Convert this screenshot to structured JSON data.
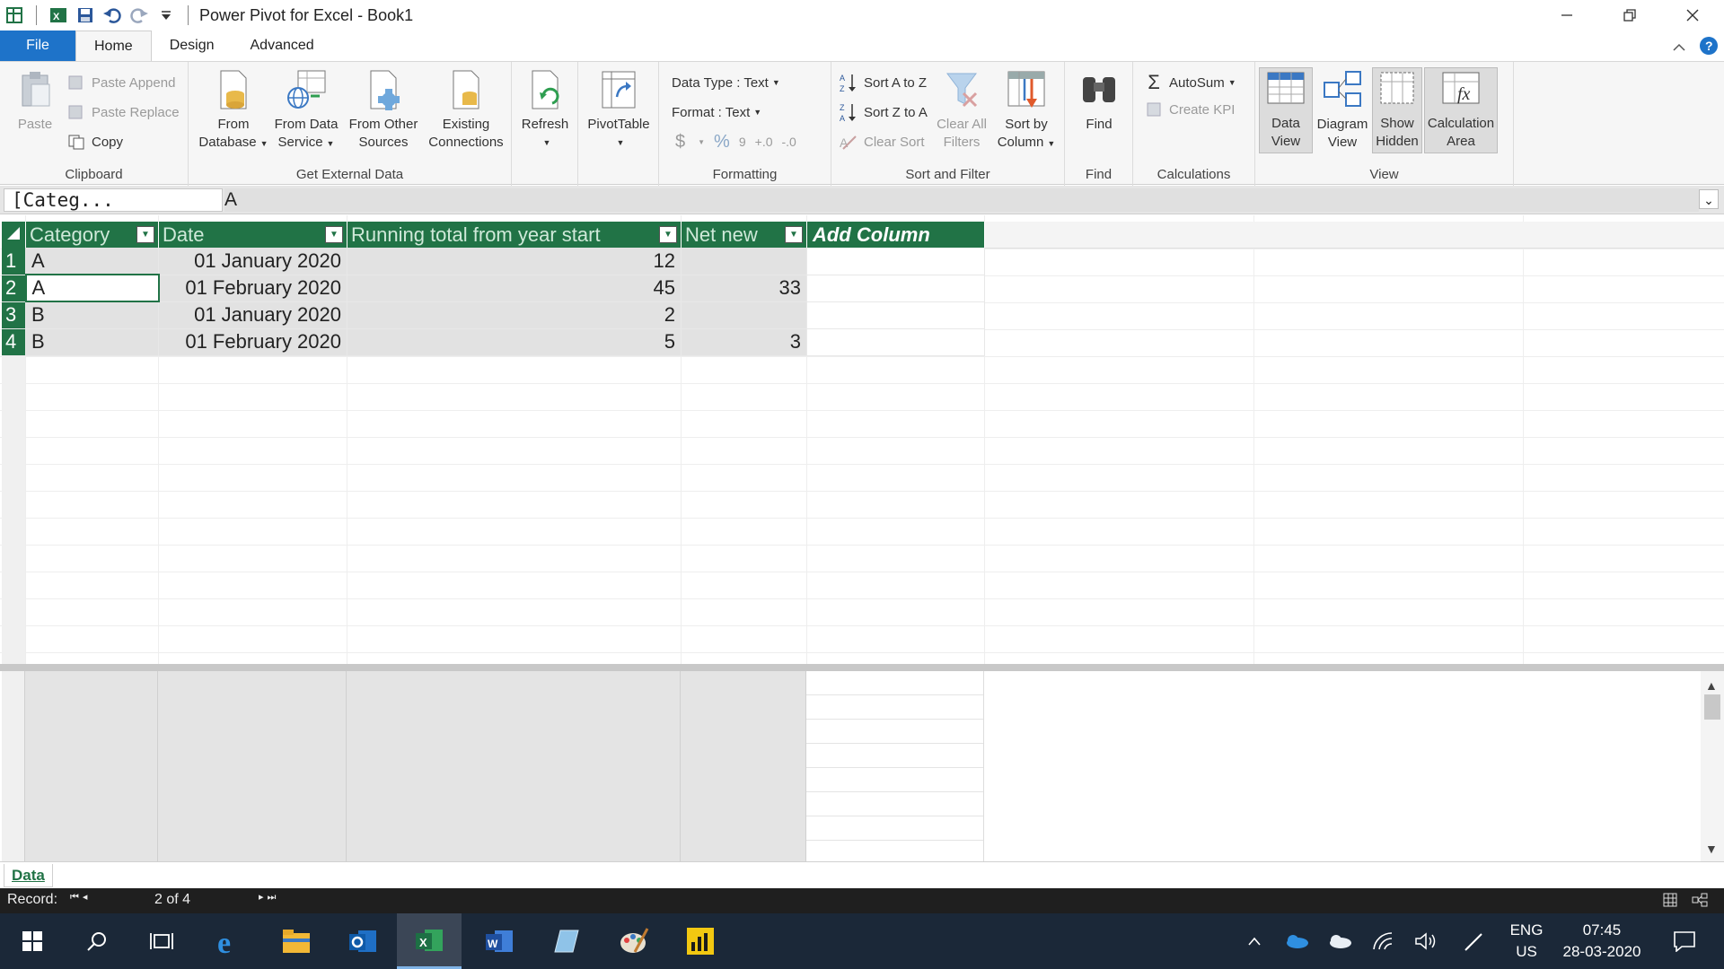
{
  "window": {
    "title": "Power Pivot for Excel - Book1"
  },
  "tabs": [
    {
      "label": "File"
    },
    {
      "label": "Home"
    },
    {
      "label": "Design"
    },
    {
      "label": "Advanced"
    }
  ],
  "ribbon": {
    "clipboard": {
      "label": "Clipboard",
      "paste": "Paste",
      "paste_append": "Paste Append",
      "paste_replace": "Paste Replace",
      "copy": "Copy"
    },
    "external": {
      "label": "Get External Data",
      "from_database_1": "From",
      "from_database_2": "Database",
      "from_data_service_1": "From Data",
      "from_data_service_2": "Service",
      "from_other_1": "From Other",
      "from_other_2": "Sources",
      "existing_1": "Existing",
      "existing_2": "Connections"
    },
    "refresh": {
      "label": "Refresh"
    },
    "pivottable": {
      "label": "PivotTable"
    },
    "formatting": {
      "label": "Formatting",
      "data_type": "Data Type : Text",
      "format": "Format : Text",
      "currency": "$",
      "percent": "%",
      "comma": "9",
      "inc_decimal": "+.0",
      "dec_decimal": "-.0"
    },
    "sortfilter": {
      "label": "Sort and Filter",
      "sort_az": "Sort A to Z",
      "sort_za": "Sort Z to A",
      "clear_sort": "Clear Sort",
      "clear_filters_1": "Clear All",
      "clear_filters_2": "Filters",
      "sort_by_1": "Sort by",
      "sort_by_2": "Column"
    },
    "find": {
      "label": "Find",
      "button": "Find"
    },
    "calculations": {
      "label": "Calculations",
      "autosum": "AutoSum",
      "create_kpi": "Create KPI"
    },
    "view": {
      "label": "View",
      "data_view_1": "Data",
      "data_view_2": "View",
      "diagram_1": "Diagram",
      "diagram_2": "View",
      "show_hidden_1": "Show",
      "show_hidden_2": "Hidden",
      "calc_area_1": "Calculation",
      "calc_area_2": "Area"
    }
  },
  "formula_bar": {
    "name_box": "[Categ...",
    "value": "A"
  },
  "table": {
    "columns": [
      "Category",
      "Date",
      "Running total from year start",
      "Net new",
      "Add Column"
    ],
    "rows": [
      {
        "n": "1",
        "category": "A",
        "date": "01 January 2020",
        "total": "12",
        "net": ""
      },
      {
        "n": "2",
        "category": "A",
        "date": "01 February 2020",
        "total": "45",
        "net": "33"
      },
      {
        "n": "3",
        "category": "B",
        "date": "01 January 2020",
        "total": "2",
        "net": ""
      },
      {
        "n": "4",
        "category": "B",
        "date": "01 February 2020",
        "total": "5",
        "net": "3"
      }
    ]
  },
  "sheet_tab": "Data",
  "status": {
    "record_label": "Record:",
    "record_value": "2 of 4"
  },
  "tray": {
    "lang_1": "ENG",
    "lang_2": "US",
    "time": "07:45",
    "date": "28-03-2020"
  },
  "colors": {
    "accent": "#217346",
    "file_tab": "#1e73c9",
    "taskbar": "#1b2838"
  }
}
